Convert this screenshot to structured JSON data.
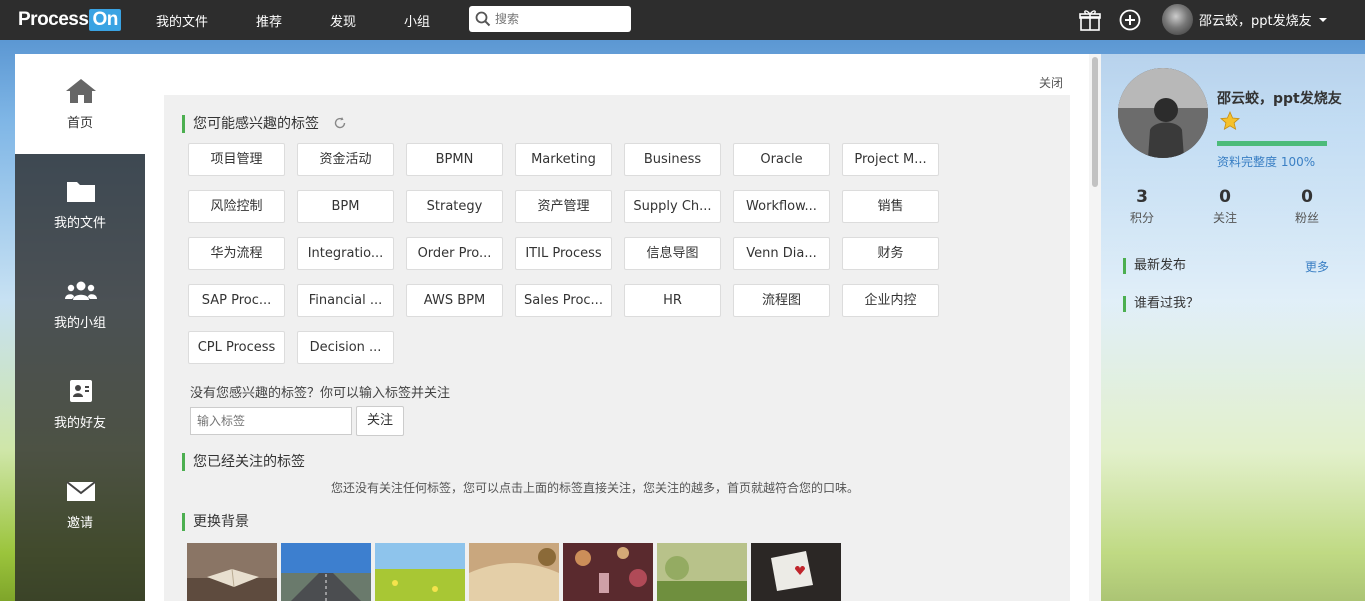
{
  "brand": {
    "name_part1": "Process",
    "name_part2": "On"
  },
  "nav": {
    "items": [
      {
        "label": "我的文件"
      },
      {
        "label": "推荐"
      },
      {
        "label": "发现"
      },
      {
        "label": "小组"
      }
    ],
    "search_placeholder": "搜索"
  },
  "top_right": {
    "gift_icon": "gift-icon",
    "add_icon": "plus-circle-icon",
    "username": "邵云蛟，ppt发烧友"
  },
  "sidebar": {
    "items": [
      {
        "label": "首页",
        "icon": "home-icon"
      },
      {
        "label": "我的文件",
        "icon": "folder-icon"
      },
      {
        "label": "我的小组",
        "icon": "group-icon"
      },
      {
        "label": "我的好友",
        "icon": "contact-card-icon"
      },
      {
        "label": "邀请",
        "icon": "mail-icon"
      }
    ]
  },
  "main": {
    "close_label": "关闭",
    "interest_title": "您可能感兴趣的标签",
    "tags": [
      "项目管理",
      "资金活动",
      "BPMN",
      "Marketing",
      "Business",
      "Oracle",
      "Project M...",
      "风险控制",
      "BPM",
      "Strategy",
      "资产管理",
      "Supply Ch...",
      "Workflow...",
      "销售",
      "华为流程",
      "Integratio...",
      "Order Pro...",
      "ITIL Process",
      "信息导图",
      "Venn Dia...",
      "财务",
      "SAP Proc...",
      "Financial ...",
      "AWS BPM",
      "Sales Proc...",
      "HR",
      "流程图",
      "企业内控",
      "CPL Process",
      "Decision ..."
    ],
    "hint": "没有您感兴趣的标签？你可以输入标签并关注",
    "input_placeholder": "输入标签",
    "follow_label": "关注",
    "followed_title": "您已经关注的标签",
    "followed_empty": "您还没有关注任何标签，您可以点击上面的标签直接关注，您关注的越多，首页就越符合您的口味。",
    "background_title": "更换背景"
  },
  "profile": {
    "name": "邵云蛟，ppt发烧友",
    "completeness_label": "资料完整度 100%",
    "completeness": 1.0,
    "stats": [
      {
        "value": "3",
        "label": "积分"
      },
      {
        "value": "0",
        "label": "关注"
      },
      {
        "value": "0",
        "label": "粉丝"
      }
    ],
    "latest_title": "最新发布",
    "more_label": "更多",
    "visitors_title": "谁看过我？"
  },
  "colors": {
    "accent_green": "#4caf50",
    "link_blue": "#3a7fc4",
    "topbar": "#2d2d2d"
  }
}
